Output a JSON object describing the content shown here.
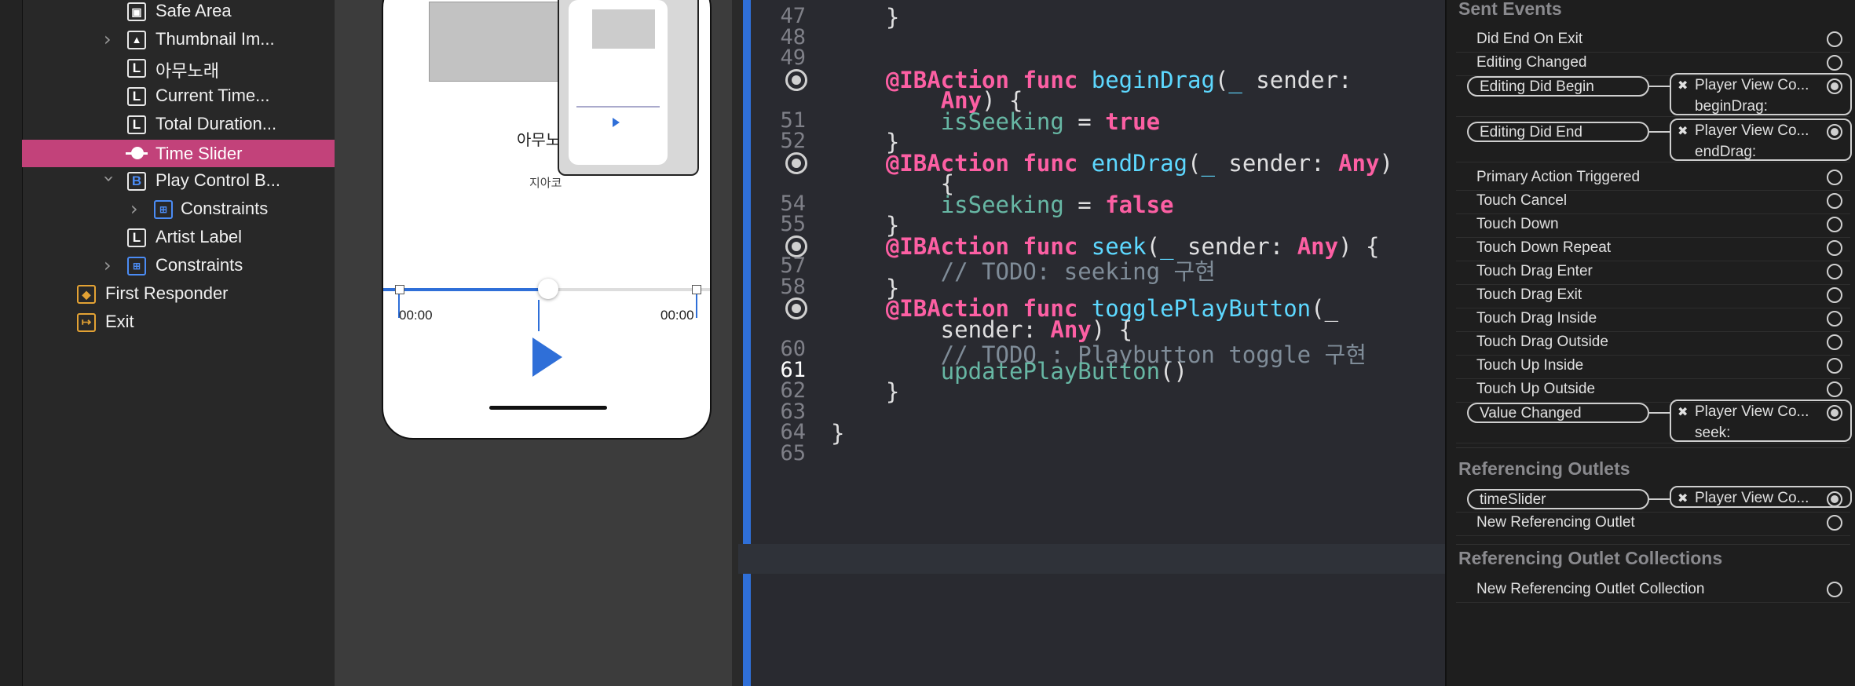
{
  "navigator": {
    "items": [
      {
        "label": "Safe Area",
        "icon": "safe-area-icon"
      },
      {
        "label": "Thumbnail Im...",
        "icon": "image-view-icon"
      },
      {
        "label": "아무노래",
        "icon": "label-icon"
      },
      {
        "label": "Current Time...",
        "icon": "label-icon"
      },
      {
        "label": "Total Duration...",
        "icon": "label-icon"
      },
      {
        "label": "Time Slider",
        "icon": "slider-icon"
      },
      {
        "label": "Play Control B...",
        "icon": "button-icon"
      },
      {
        "label": "Constraints",
        "icon": "constraints-icon"
      },
      {
        "label": "Artist Label",
        "icon": "label-icon"
      },
      {
        "label": "Constraints",
        "icon": "constraints-icon"
      },
      {
        "label": "First Responder",
        "icon": "first-responder-icon"
      },
      {
        "label": "Exit",
        "icon": "exit-icon"
      }
    ],
    "label_glyph": "L",
    "button_glyph": "B"
  },
  "canvas": {
    "song_title": "아무노",
    "artist": "지아코",
    "current_time": "00:00",
    "total_time": "00:00",
    "slider_value": 0.5
  },
  "editor": {
    "lines": [
      {
        "n": "47",
        "text": "    }"
      },
      {
        "n": "48",
        "text": ""
      },
      {
        "n": "49",
        "text": ""
      },
      {
        "n": "",
        "text": "    @IBAction func beginDrag(_ sender:"
      },
      {
        "n": "",
        "text": "        Any) {"
      },
      {
        "n": "51",
        "text": "        isSeeking = true"
      },
      {
        "n": "52",
        "text": "    }"
      },
      {
        "n": "",
        "text": "    @IBAction func endDrag(_ sender: Any)"
      },
      {
        "n": "",
        "text": "        {"
      },
      {
        "n": "54",
        "text": "        isSeeking = false"
      },
      {
        "n": "55",
        "text": "    }"
      },
      {
        "n": "",
        "text": "    @IBAction func seek(_ sender: Any) {"
      },
      {
        "n": "57",
        "text": "        // TODO: seeking 구현"
      },
      {
        "n": "58",
        "text": "    }"
      },
      {
        "n": "",
        "text": "    @IBAction func togglePlayButton(_"
      },
      {
        "n": "",
        "text": "        sender: Any) {"
      },
      {
        "n": "60",
        "text": "        // TODO : Playbutton toggle 구현"
      },
      {
        "n": "61",
        "text": "        updatePlayButton()"
      },
      {
        "n": "62",
        "text": "    }"
      },
      {
        "n": "63",
        "text": ""
      },
      {
        "n": "64",
        "text": "}"
      },
      {
        "n": "65",
        "text": ""
      }
    ]
  },
  "inspector": {
    "sent_events_title": "Sent Events",
    "events": [
      {
        "label": "Did End On Exit"
      },
      {
        "label": "Editing Changed"
      },
      {
        "label": "Editing Did Begin",
        "target": "Player View Co...",
        "action": "beginDrag:"
      },
      {
        "label": "Editing Did End",
        "target": "Player View Co...",
        "action": "endDrag:"
      },
      {
        "label": "Primary Action Triggered"
      },
      {
        "label": "Touch Cancel"
      },
      {
        "label": "Touch Down"
      },
      {
        "label": "Touch Down Repeat"
      },
      {
        "label": "Touch Drag Enter"
      },
      {
        "label": "Touch Drag Exit"
      },
      {
        "label": "Touch Drag Inside"
      },
      {
        "label": "Touch Drag Outside"
      },
      {
        "label": "Touch Up Inside"
      },
      {
        "label": "Touch Up Outside"
      },
      {
        "label": "Value Changed",
        "target": "Player View Co...",
        "action": "seek:"
      }
    ],
    "ref_outlets_title": "Referencing Outlets",
    "ref_outlets": [
      {
        "label": "timeSlider",
        "target": "Player View Co..."
      },
      {
        "label": "New Referencing Outlet"
      }
    ],
    "ref_collections_title": "Referencing Outlet Collections",
    "ref_collections": [
      {
        "label": "New Referencing Outlet Collection"
      }
    ],
    "remove_glyph": "✖"
  }
}
